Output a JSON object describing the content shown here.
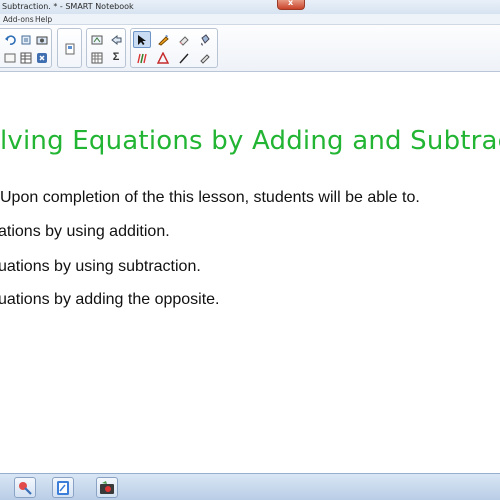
{
  "window": {
    "title": "Subtraction. * - SMART Notebook",
    "close_glyph": "x"
  },
  "menu": {
    "items": [
      "Add-ons",
      "Help"
    ]
  },
  "toolbar": {
    "icons": [
      "undo-icon",
      "redo-icon",
      "view-icon",
      "screen-shade-icon",
      "table-icon",
      "delete-icon",
      "capture-icon",
      "magic-pen-icon",
      "select-icon",
      "pen-icon",
      "eraser-icon",
      "lines-icon",
      "shapes-icon",
      "text-icon",
      "fill-icon",
      "properties-icon"
    ],
    "sigma_glyph": "Σ"
  },
  "slide": {
    "title": "lving Equations by Adding and Subtrac",
    "lines": [
      "Upon completion of the this lesson, students will be able to.",
      "ations by using addition.",
      "uations by using subtraction.",
      "uations by adding the opposite."
    ]
  },
  "colors": {
    "title_green": "#22b533",
    "accent_blue": "#3b7dd8",
    "close_red": "#c9432a"
  }
}
